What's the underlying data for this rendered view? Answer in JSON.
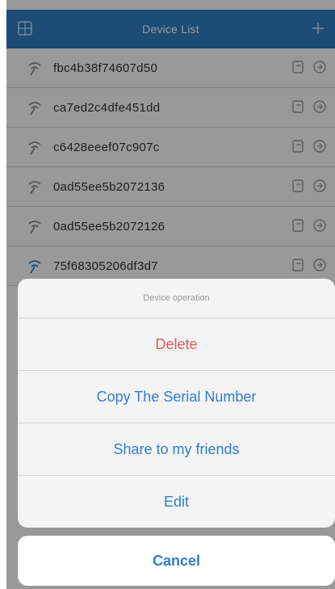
{
  "nav": {
    "title": "Device List",
    "left_icon": "grid-icon",
    "right_icon": "plus-icon",
    "bar_color": "#2f7fc4"
  },
  "devices": [
    {
      "serial": "fbc4b38f74607d50"
    },
    {
      "serial": "ca7ed2c4dfe451dd"
    },
    {
      "serial": "c6428eeef07c907c"
    },
    {
      "serial": "0ad55ee5b2072136"
    },
    {
      "serial": "0ad55ee5b2072126"
    },
    {
      "serial": "75f68305206df3d7"
    }
  ],
  "sheet": {
    "title": "Device operation",
    "items": [
      {
        "label": "Delete"
      },
      {
        "label": "Copy The Serial Number"
      },
      {
        "label": "Share to my friends"
      },
      {
        "label": "Edit"
      }
    ],
    "cancel_label": "Cancel",
    "accent_color": "#2e7dd1",
    "danger_color": "#e05a5a"
  }
}
